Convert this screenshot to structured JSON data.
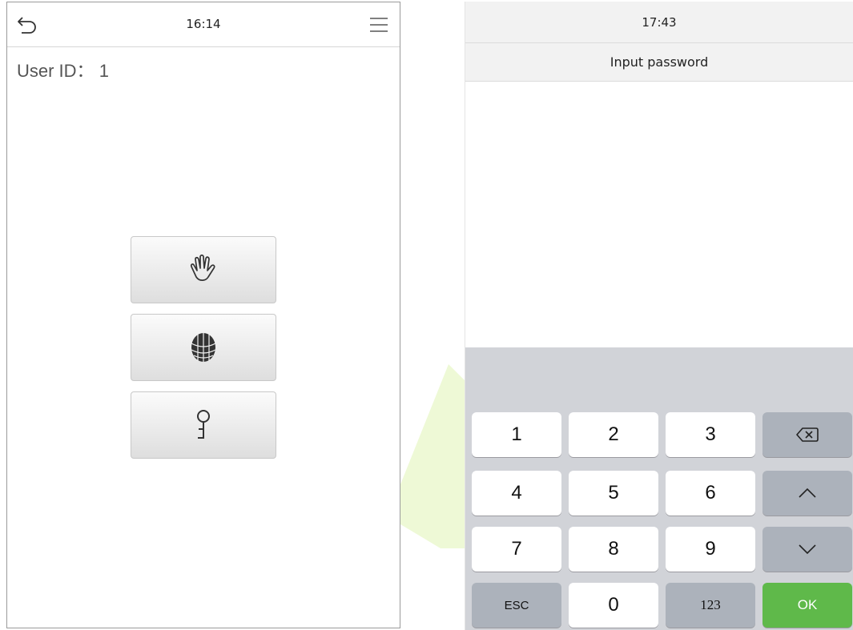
{
  "left_screen": {
    "time": "16:14",
    "user_id_label": "User ID：",
    "user_id_value": "1",
    "verify_buttons": [
      "palm-icon",
      "face-icon",
      "password-key-icon"
    ]
  },
  "right_screen": {
    "time": "17:43",
    "title": "Input password",
    "keys": {
      "k1": "1",
      "k2": "2",
      "k3": "3",
      "k4": "4",
      "k5": "5",
      "k6": "6",
      "k7": "7",
      "k8": "8",
      "k9": "9",
      "esc": "ESC",
      "k0": "0",
      "sym": "123",
      "ok": "OK"
    }
  },
  "colors": {
    "ok_key": "#5fb94a",
    "function_key": "#acb2bb",
    "keyboard_bg": "#d1d3d8",
    "watermark": "#e8f7c8"
  }
}
